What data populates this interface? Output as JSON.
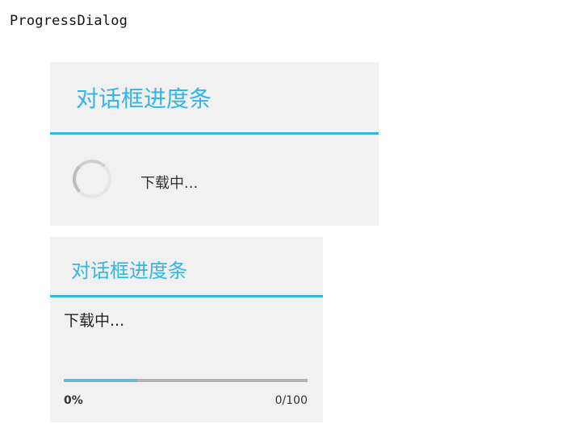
{
  "page": {
    "heading": "ProgressDialog"
  },
  "spinner_dialog": {
    "title": "对话框进度条",
    "message": "下载中...",
    "indicator_icon": "spinner-icon",
    "accent_color": "#33b5e5"
  },
  "horizontal_dialog": {
    "title": "对话框进度条",
    "message": "下载中...",
    "progress": {
      "value": 0,
      "max": 100,
      "secondary_fraction": 0.3,
      "percent_text": "0%",
      "count_text": "0/100"
    },
    "accent_color": "#33b5e5"
  }
}
